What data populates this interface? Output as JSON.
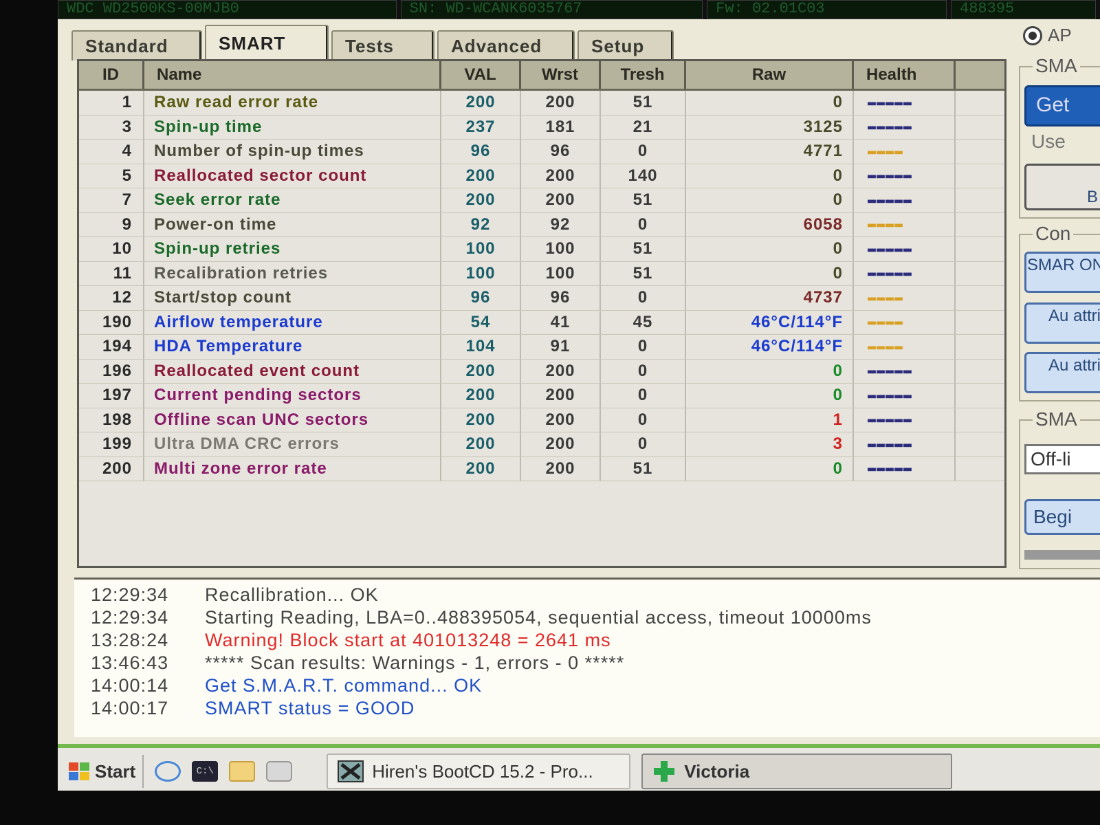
{
  "top_bar": {
    "model": "WDC WD2500KS-00MJB0",
    "serial": "SN: WD-WCANK6035767",
    "firmware": "Fw: 02.01C03",
    "lba": "488395"
  },
  "tabs": [
    {
      "label": "Standard",
      "active": false
    },
    {
      "label": "SMART",
      "active": true
    },
    {
      "label": "Tests",
      "active": false
    },
    {
      "label": "Advanced",
      "active": false
    },
    {
      "label": "Setup",
      "active": false
    }
  ],
  "radio_label": "AP",
  "table": {
    "headers": [
      "ID",
      "Name",
      "VAL",
      "Wrst",
      "Tresh",
      "Raw",
      "Health"
    ],
    "rows": [
      {
        "id": "1",
        "name": "Raw read error rate",
        "val": "200",
        "wrst": "200",
        "tresh": "51",
        "raw": "0",
        "health": "▬▬▬▬▬",
        "name_color": "#5a5a12",
        "raw_color": "#4a4a2a",
        "health_color": "#2c2c7c"
      },
      {
        "id": "3",
        "name": "Spin-up time",
        "val": "237",
        "wrst": "181",
        "tresh": "21",
        "raw": "3125",
        "health": "▬▬▬▬▬",
        "name_color": "#1a6a2a",
        "raw_color": "#4a4a2a",
        "health_color": "#2c2c7c"
      },
      {
        "id": "4",
        "name": "Number of spin-up times",
        "val": "96",
        "wrst": "96",
        "tresh": "0",
        "raw": "4771",
        "health": "▬▬▬▬",
        "name_color": "#4a4a3a",
        "raw_color": "#4a4a2a",
        "health_color": "#d9a023"
      },
      {
        "id": "5",
        "name": "Reallocated sector count",
        "val": "200",
        "wrst": "200",
        "tresh": "140",
        "raw": "0",
        "health": "▬▬▬▬▬",
        "name_color": "#8a1a3a",
        "raw_color": "#4a4a2a",
        "health_color": "#2c2c7c"
      },
      {
        "id": "7",
        "name": "Seek error rate",
        "val": "200",
        "wrst": "200",
        "tresh": "51",
        "raw": "0",
        "health": "▬▬▬▬▬",
        "name_color": "#1a6a2a",
        "raw_color": "#4a4a2a",
        "health_color": "#2c2c7c"
      },
      {
        "id": "9",
        "name": "Power-on time",
        "val": "92",
        "wrst": "92",
        "tresh": "0",
        "raw": "6058",
        "health": "▬▬▬▬",
        "name_color": "#4a4a3a",
        "raw_color": "#7a2a2a",
        "health_color": "#d9a023"
      },
      {
        "id": "10",
        "name": "Spin-up retries",
        "val": "100",
        "wrst": "100",
        "tresh": "51",
        "raw": "0",
        "health": "▬▬▬▬▬",
        "name_color": "#1a6a2a",
        "raw_color": "#4a4a2a",
        "health_color": "#2c2c7c"
      },
      {
        "id": "11",
        "name": "Recalibration retries",
        "val": "100",
        "wrst": "100",
        "tresh": "51",
        "raw": "0",
        "health": "▬▬▬▬▬",
        "name_color": "#5a5a52",
        "raw_color": "#4a4a2a",
        "health_color": "#2c2c7c"
      },
      {
        "id": "12",
        "name": "Start/stop count",
        "val": "96",
        "wrst": "96",
        "tresh": "0",
        "raw": "4737",
        "health": "▬▬▬▬",
        "name_color": "#4a4a3a",
        "raw_color": "#7a2a2a",
        "health_color": "#d9a023"
      },
      {
        "id": "190",
        "name": "Airflow temperature",
        "val": "54",
        "wrst": "41",
        "tresh": "45",
        "raw": "46°C/114°F",
        "health": "▬▬▬▬",
        "name_color": "#1a3ad0",
        "raw_color": "#1a3ad0",
        "health_color": "#d9a023"
      },
      {
        "id": "194",
        "name": "HDA Temperature",
        "val": "104",
        "wrst": "91",
        "tresh": "0",
        "raw": "46°C/114°F",
        "health": "▬▬▬▬",
        "name_color": "#1a3ad0",
        "raw_color": "#1a3ad0",
        "health_color": "#d9a023"
      },
      {
        "id": "196",
        "name": "Reallocated event count",
        "val": "200",
        "wrst": "200",
        "tresh": "0",
        "raw": "0",
        "health": "▬▬▬▬▬",
        "name_color": "#8a1a3a",
        "raw_color": "#1a8a2a",
        "health_color": "#2c2c7c"
      },
      {
        "id": "197",
        "name": "Current pending sectors",
        "val": "200",
        "wrst": "200",
        "tresh": "0",
        "raw": "0",
        "health": "▬▬▬▬▬",
        "name_color": "#8a1a6a",
        "raw_color": "#1a8a2a",
        "health_color": "#2c2c7c"
      },
      {
        "id": "198",
        "name": "Offline scan UNC sectors",
        "val": "200",
        "wrst": "200",
        "tresh": "0",
        "raw": "1",
        "health": "▬▬▬▬▬",
        "name_color": "#8a1a6a",
        "raw_color": "#d02020",
        "health_color": "#2c2c7c"
      },
      {
        "id": "199",
        "name": "Ultra DMA CRC errors",
        "val": "200",
        "wrst": "200",
        "tresh": "0",
        "raw": "3",
        "health": "▬▬▬▬▬",
        "name_color": "#7a7a72",
        "raw_color": "#d02020",
        "health_color": "#2c2c7c"
      },
      {
        "id": "200",
        "name": "Multi zone error rate",
        "val": "200",
        "wrst": "200",
        "tresh": "51",
        "raw": "0",
        "health": "▬▬▬▬▬",
        "name_color": "#8a1a6a",
        "raw_color": "#1a8a2a",
        "health_color": "#2c2c7c"
      }
    ]
  },
  "side_panel": {
    "group1_title": "SMA",
    "get_button": "Get",
    "use_label": "Use",
    "open_button": "B",
    "group2_title": "Con",
    "smart_on_button": "SMAR ON",
    "auto_attr_button1": "Au attri",
    "auto_attr_button2": "Au attri",
    "group3_title": "SMA",
    "offline_field": "Off-li",
    "begin_button": "Begi"
  },
  "log": [
    {
      "time": "12:29:34",
      "message": "Recallibration... OK",
      "color": "#444444"
    },
    {
      "time": "12:29:34",
      "message": "Starting Reading, LBA=0..488395054, sequential access, timeout 10000ms",
      "color": "#444444"
    },
    {
      "time": "13:28:24",
      "message": "Warning! Block start at 401013248 = 2641 ms",
      "color": "#e02a2a"
    },
    {
      "time": "13:46:43",
      "message": "***** Scan results: Warnings - 1, errors - 0 *****",
      "color": "#444444"
    },
    {
      "time": "14:00:14",
      "message": "Get S.M.A.R.T. command... OK",
      "color": "#2050c8"
    },
    {
      "time": "14:00:17",
      "message": "SMART status = GOOD",
      "color": "#2050c8"
    }
  ],
  "taskbar": {
    "start_label": "Start",
    "task1": "Hiren's BootCD 15.2 - Pro...",
    "task2": "Victoria"
  }
}
